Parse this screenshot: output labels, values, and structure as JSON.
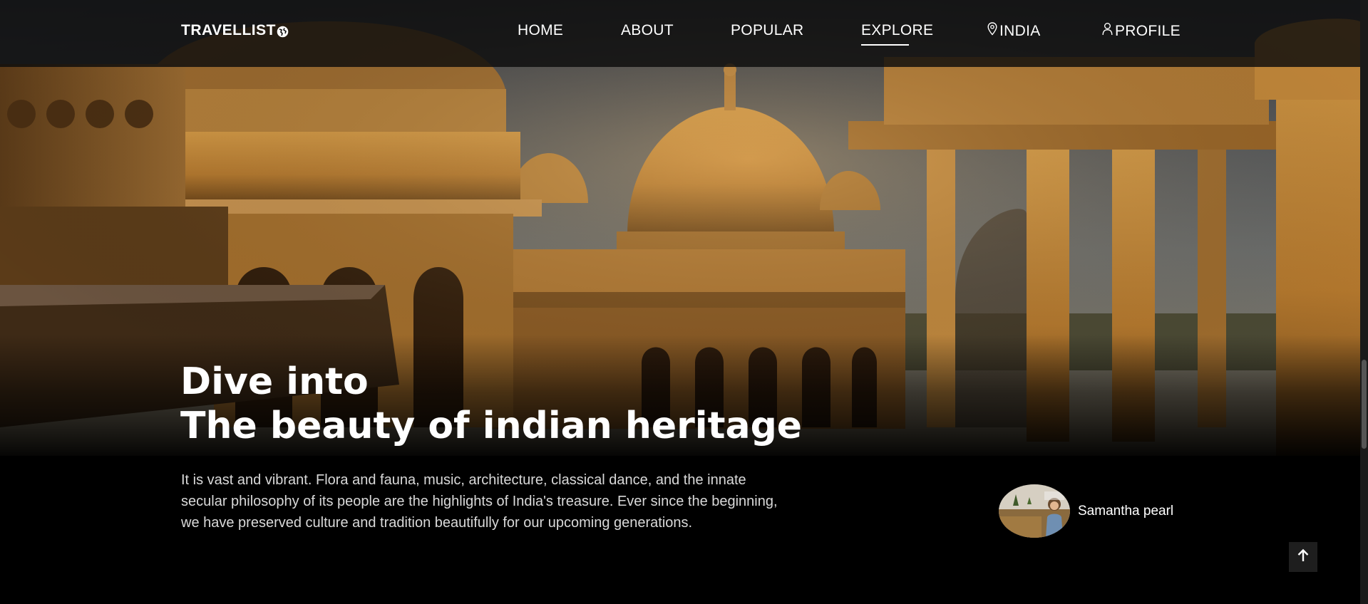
{
  "navbar": {
    "brand": "TRAVELLIST",
    "brand_icon": "globe-icon",
    "links": [
      {
        "label": "HOME"
      },
      {
        "label": "ABOUT"
      },
      {
        "label": "POPULAR"
      },
      {
        "label": "EXPLORE",
        "active": true
      },
      {
        "label": "INDIA",
        "icon": "location-pin-icon"
      },
      {
        "label": "PROFILE",
        "icon": "user-icon"
      }
    ]
  },
  "hero": {
    "title_line1": "Dive into",
    "title_line2": "The beauty of indian heritage",
    "description": "It is vast and vibrant. Flora and fauna, music, architecture, classical dance, and the innate secular philosophy of its people are the highlights of India's treasure. Ever since the beginning, we have preserved culture and tradition beautifully for our upcoming generations."
  },
  "author": {
    "name": "Samantha pearl"
  },
  "scroll_top": {
    "icon": "arrow-up-icon"
  },
  "colors": {
    "background": "#000000",
    "navbar": "#0c0c0c",
    "sandstone": "#c78a3a",
    "text": "#ffffff",
    "muted_text": "#d9d9d9"
  }
}
